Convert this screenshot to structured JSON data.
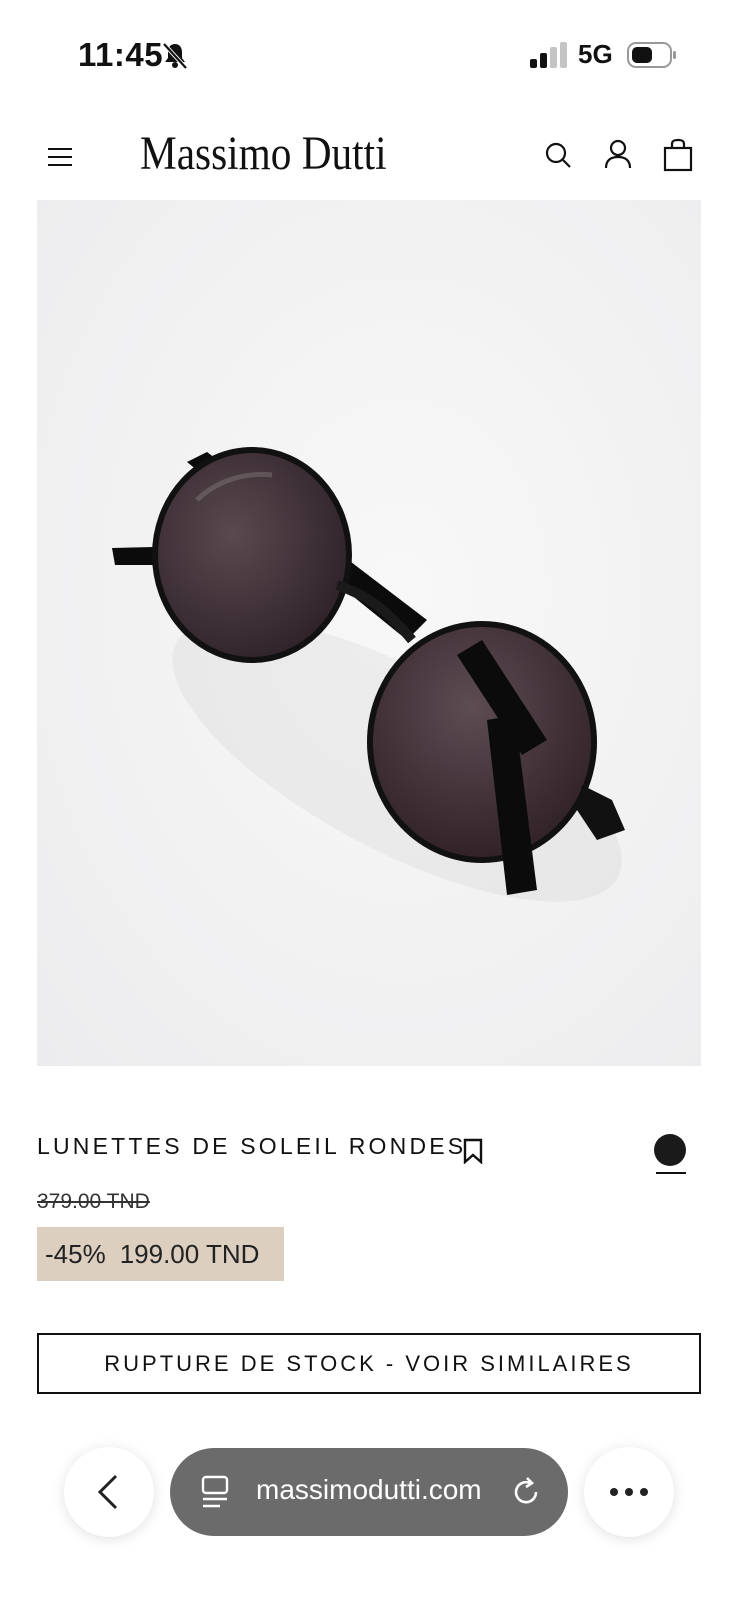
{
  "status_bar": {
    "time": "11:45",
    "network": "5G",
    "icons": [
      "bell-slash-icon",
      "signal-icon",
      "battery-icon"
    ]
  },
  "header": {
    "brand": "Massimo Dutti",
    "icons": [
      "menu-icon",
      "search-icon",
      "account-icon",
      "bag-icon"
    ]
  },
  "product": {
    "image_alt": "Round sunglasses",
    "title": "LUNETTES DE SOLEIL RONDES",
    "old_price": "379.00 TND",
    "discount": "-45%",
    "price": "199.00 TND",
    "color_swatch": "#1a1a1a",
    "oos_button_label": "RUPTURE DE STOCK - VOIR SIMILAIRES"
  },
  "browser": {
    "url": "massimodutti.com",
    "icons": [
      "back-icon",
      "tabs-icon",
      "reload-icon",
      "more-icon"
    ]
  },
  "colors": {
    "sale_background": "#dccfc0",
    "url_bar_background": "#6b6b6b"
  }
}
